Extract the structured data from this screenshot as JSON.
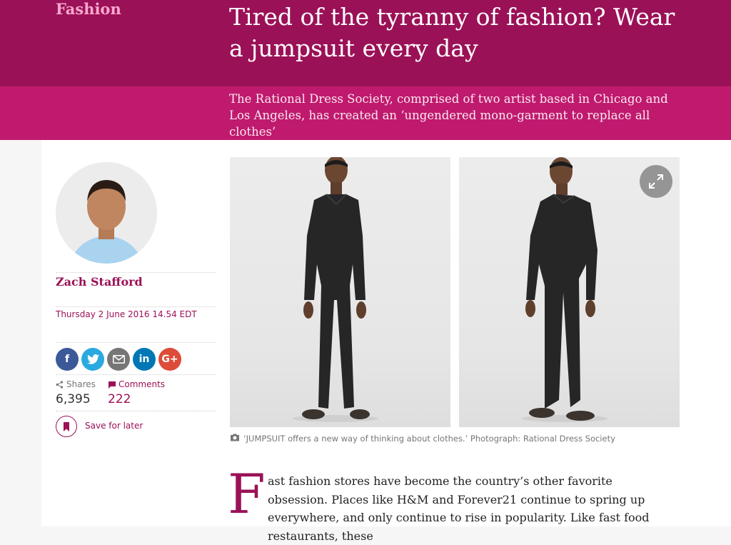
{
  "header": {
    "section": "Fashion",
    "headline": "Tired of the tyranny of fashion? Wear a jumpsuit every day",
    "standfirst": "The Rational Dress Society, comprised of two artist based in Chicago and Los Angeles, has created an ‘ungendered mono-garment to replace all clothes’"
  },
  "author": {
    "name": "Zach Stafford",
    "date": "Thursday 2 June 2016 14.54 EDT"
  },
  "share": {
    "buttons": [
      {
        "label": "f",
        "icon": "facebook-icon",
        "color": "#3b5998"
      },
      {
        "label": "",
        "icon": "twitter-icon",
        "color": "#2aa9e0"
      },
      {
        "label": "",
        "icon": "email-icon",
        "color": "#767676"
      },
      {
        "label": "in",
        "icon": "linkedin-icon",
        "color": "#0077b5"
      },
      {
        "label": "G+",
        "icon": "googleplus-icon",
        "color": "#dd4b39"
      }
    ],
    "shares_label": "Shares",
    "shares_count": "6,395",
    "comments_label": "Comments",
    "comments_count": "222",
    "save_label": "Save for later"
  },
  "media": {
    "caption": "‘JUMPSUIT offers a new way of thinking about clothes.’ Photograph: Rational Dress Society"
  },
  "article": {
    "dropcap": "F",
    "lead": "ast fashion stores have become the country’s other favorite obsession. Places like H&M and Forever21 continue to spring up everywhere, and only continue to rise in popularity. Like fast food restaurants, these"
  },
  "colors": {
    "accent": "#9b1157",
    "header_band": "#bf1a6e",
    "section_label": "#f9a8cf"
  }
}
